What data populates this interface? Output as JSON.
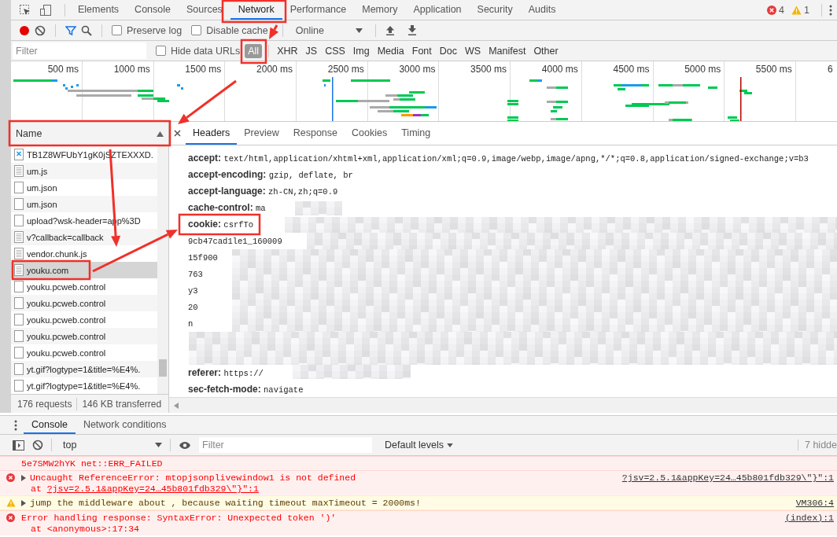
{
  "main_tabs": [
    {
      "label": "Elements",
      "selected": false
    },
    {
      "label": "Console",
      "selected": false
    },
    {
      "label": "Sources",
      "selected": false
    },
    {
      "label": "Network",
      "selected": true
    },
    {
      "label": "Performance",
      "selected": false
    },
    {
      "label": "Memory",
      "selected": false
    },
    {
      "label": "Application",
      "selected": false
    },
    {
      "label": "Security",
      "selected": false
    },
    {
      "label": "Audits",
      "selected": false
    }
  ],
  "issue_counts": {
    "errors": "4",
    "warnings": "1"
  },
  "toolbar": {
    "recording": true,
    "filter_shown": true,
    "checkboxes": [
      {
        "label": "Preserve log",
        "checked": false
      },
      {
        "label": "Disable cache",
        "checked": false
      }
    ],
    "throttling": "Online"
  },
  "filter_bar": {
    "placeholder": "Filter",
    "hide_data_urls": {
      "label": "Hide data URLs",
      "checked": false
    },
    "types": [
      {
        "label": "All",
        "selected": true
      },
      {
        "label": "XHR",
        "selected": false
      },
      {
        "label": "JS",
        "selected": false
      },
      {
        "label": "CSS",
        "selected": false
      },
      {
        "label": "Img",
        "selected": false
      },
      {
        "label": "Media",
        "selected": false
      },
      {
        "label": "Font",
        "selected": false
      },
      {
        "label": "Doc",
        "selected": false
      },
      {
        "label": "WS",
        "selected": false
      },
      {
        "label": "Manifest",
        "selected": false
      },
      {
        "label": "Other",
        "selected": false
      }
    ]
  },
  "timeline": {
    "ticks": [
      "500 ms",
      "1000 ms",
      "1500 ms",
      "2000 ms",
      "2500 ms",
      "3000 ms",
      "3500 ms",
      "4000 ms",
      "4500 ms",
      "5000 ms",
      "5500 ms",
      "6"
    ]
  },
  "requests": {
    "column": "Name",
    "rows": [
      {
        "name": "TB1Z8WFUbY1gK0jSZTEXXXD.",
        "kind": "image",
        "selected": false
      },
      {
        "name": "um.js",
        "kind": "document",
        "selected": false
      },
      {
        "name": "um.json",
        "kind": "blank",
        "selected": false
      },
      {
        "name": "um.json",
        "kind": "blank",
        "selected": false
      },
      {
        "name": "upload?wsk-header=app%3D",
        "kind": "blank",
        "selected": false
      },
      {
        "name": "v?callback=callback",
        "kind": "document",
        "selected": false
      },
      {
        "name": "vendor.chunk.js",
        "kind": "document",
        "selected": false
      },
      {
        "name": "youku.com",
        "kind": "document",
        "selected": true
      },
      {
        "name": "youku.pcweb.control",
        "kind": "blank",
        "selected": false
      },
      {
        "name": "youku.pcweb.control",
        "kind": "blank",
        "selected": false
      },
      {
        "name": "youku.pcweb.control",
        "kind": "blank",
        "selected": false
      },
      {
        "name": "youku.pcweb.control",
        "kind": "blank",
        "selected": false
      },
      {
        "name": "youku.pcweb.control",
        "kind": "blank",
        "selected": false
      },
      {
        "name": "yt.gif?logtype=1&title=%E4%.",
        "kind": "blank",
        "selected": false
      },
      {
        "name": "yt.gif?logtype=1&title=%E4%.",
        "kind": "blank",
        "selected": false
      }
    ],
    "summary": [
      "176 requests",
      "146 KB transferred"
    ]
  },
  "details": {
    "tabs": [
      {
        "label": "Headers",
        "selected": true
      },
      {
        "label": "Preview",
        "selected": false
      },
      {
        "label": "Response",
        "selected": false
      },
      {
        "label": "Cookies",
        "selected": false
      },
      {
        "label": "Timing",
        "selected": false
      }
    ],
    "headers": [
      {
        "name": "accept:",
        "value": "text/html,application/xhtml+xml,application/xml;q=0.9,image/webp,image/apng,*/*;q=0.8,application/signed-exchange;v=b3"
      },
      {
        "name": "accept-encoding:",
        "value": "gzip, deflate, br"
      },
      {
        "name": "accept-language:",
        "value": "zh-CN,zh;q=0.9"
      },
      {
        "name": "cache-control:",
        "value": "ma"
      },
      {
        "name": "cookie:",
        "value": "csrfTo"
      }
    ],
    "cookie_fragments": [
      "9cb47cad1le1_160009",
      "15f900",
      "763",
      "y3",
      "20",
      "n"
    ],
    "more_headers": [
      {
        "name": "referer:",
        "value": "https://"
      },
      {
        "name": "sec-fetch-mode:",
        "value": "navigate"
      }
    ]
  },
  "drawer": {
    "tabs": [
      {
        "label": "Console",
        "selected": true
      },
      {
        "label": "Network conditions",
        "selected": false
      }
    ],
    "context": "top",
    "filter_placeholder": "Filter",
    "levels": "Default levels",
    "hidden": "7 hidde"
  },
  "messages": [
    {
      "kind": "error",
      "expandable": false,
      "text": "5e7SMW2hYK net::ERR_FAILED"
    },
    {
      "kind": "error",
      "expandable": true,
      "text": "Uncaught ReferenceError: mtopjsonplivewindow1 is not defined",
      "sub_prefix": "at ",
      "sub_link": "?jsv=2.5.1&appKey=24…45b801fdb329\\\"}\":1",
      "source": "?jsv=2.5.1&appKey=24…45b801fdb329\\\"}\":1"
    },
    {
      "kind": "warning",
      "expandable": true,
      "text": "jump the middleware about , because waiting timeout maxTimeout = 2000ms!",
      "source": "VM306:4"
    },
    {
      "kind": "error",
      "expandable": false,
      "text": "Error handling response: SyntaxError: Unexpected token ')'",
      "sub_prefix": "at <anonymous>:17:34",
      "source": "(index):1"
    }
  ]
}
